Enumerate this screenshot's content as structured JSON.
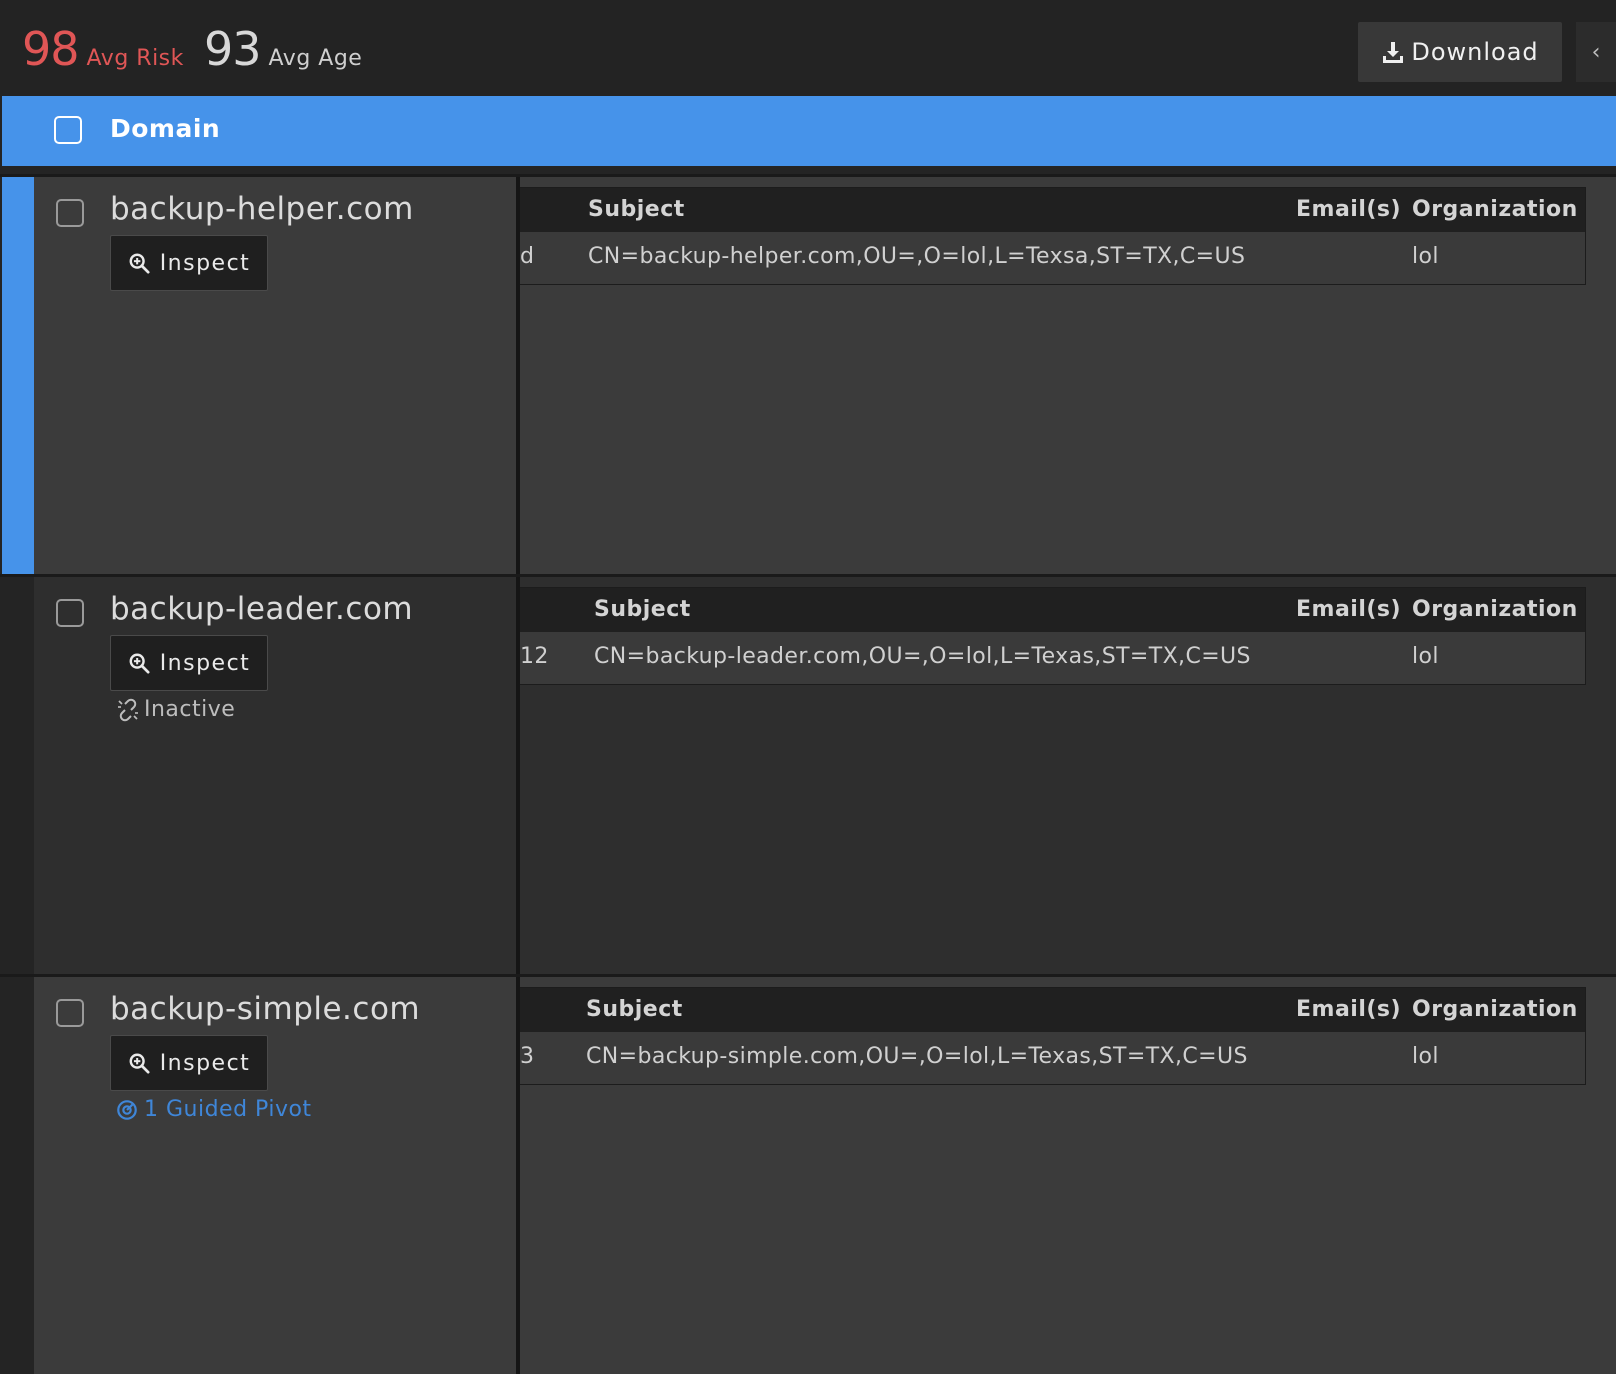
{
  "stats": {
    "avg_risk_value": "98",
    "avg_risk_label": "Avg Risk",
    "avg_age_value": "93",
    "avg_age_label": "Avg Age"
  },
  "toolbar": {
    "download_label": "Download",
    "collapse_icon": "‹"
  },
  "table_header": {
    "domain_label": "Domain"
  },
  "cert_columns": {
    "subject": "Subject",
    "emails": "Email(s)",
    "organization": "Organization"
  },
  "rows": [
    {
      "domain": "backup-helper.com",
      "inspect_label": "Inspect",
      "selected": true,
      "clipped_prefix": "d",
      "subject": "CN=backup-helper.com,OU=,O=lol,L=Texsa,ST=TX,C=US",
      "emails": "",
      "organization": "lol"
    },
    {
      "domain": "backup-leader.com",
      "inspect_label": "Inspect",
      "status": "Inactive",
      "clipped_prefix": "12",
      "subject": "CN=backup-leader.com,OU=,O=lol,L=Texas,ST=TX,C=US",
      "emails": "",
      "organization": "lol"
    },
    {
      "domain": "backup-simple.com",
      "inspect_label": "Inspect",
      "status": "1 Guided Pivot",
      "clipped_prefix": "3",
      "subject": "CN=backup-simple.com,OU=,O=lol,L=Texas,ST=TX,C=US",
      "emails": "",
      "organization": "lol"
    }
  ],
  "colors": {
    "accent": "#4693ea",
    "risk": "#e05656",
    "pivot_link": "#3f86d8"
  }
}
